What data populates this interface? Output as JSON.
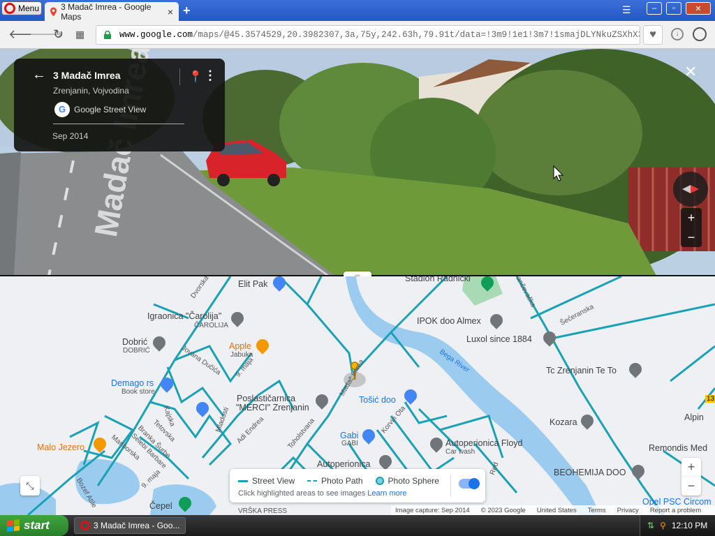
{
  "browser": {
    "menu_label": "Menu",
    "tab_title": "3 Madač Imrea - Google Maps",
    "tab_close": "×",
    "new_tab": "+",
    "url_host": "www.google.com",
    "url_path": "/maps/@45.3574529,20.3982307,3a,75y,242.63h,79.91t/data=!3m9!1e1!3m7!1smajDLYNkuZSXhX3vqZyr5A!2e0!7i",
    "window_buttons": [
      "–",
      "▫",
      "✕"
    ]
  },
  "streetview": {
    "place_title": "3 Madač Imrea",
    "place_subtitle": "Zrenjanin, Vojvodina",
    "provider": "Google Street View",
    "provider_logo": "G",
    "capture_date": "Sep 2014",
    "painted_street_text": "Madač Imrea",
    "close": "✕",
    "zoom_in": "+",
    "zoom_out": "−"
  },
  "map": {
    "labels": [
      {
        "text": "Elit Pak",
        "style": "normal"
      },
      {
        "text": "Stadion Radnički",
        "style": "normal"
      },
      {
        "text": "Pančevačka",
        "style": "sm"
      },
      {
        "text": "Igraonica \"Čarolija\"",
        "style": "normal"
      },
      {
        "text": "ČAROLIJA",
        "style": "sm"
      },
      {
        "text": "Dvorska",
        "style": "sm"
      },
      {
        "text": "IPOK doo Almex",
        "style": "normal"
      },
      {
        "text": "Šećeranska",
        "style": "sm"
      },
      {
        "text": "Luxol since 1884",
        "style": "normal"
      },
      {
        "text": "Dobrić",
        "style": "normal"
      },
      {
        "text": "DOBRIĆ",
        "style": "sm"
      },
      {
        "text": "Apple",
        "style": "orange"
      },
      {
        "text": "Jabuka",
        "style": "sm"
      },
      {
        "text": "Bega River",
        "style": "blue-sm"
      },
      {
        "text": "Tc Zrenjanin Te To",
        "style": "normal"
      },
      {
        "text": "Jovana Dučića",
        "style": "sm"
      },
      {
        "text": "9. maja",
        "style": "sm"
      },
      {
        "text": "Demago rs",
        "style": "blue"
      },
      {
        "text": "Book store",
        "style": "sm"
      },
      {
        "text": "Madač Imrea",
        "style": "sm"
      },
      {
        "text": "Poslastičarnica",
        "style": "normal"
      },
      {
        "text": "\"MERCI\" Zrenjanin",
        "style": "normal"
      },
      {
        "text": "Tošić doo",
        "style": "blue"
      },
      {
        "text": "Kozara",
        "style": "normal"
      },
      {
        "text": "Alpin",
        "style": "normal"
      },
      {
        "text": "Kajska",
        "style": "sm"
      },
      {
        "text": "Tetovska",
        "style": "sm"
      },
      {
        "text": "Mladosti",
        "style": "sm"
      },
      {
        "text": "Adi Endrea",
        "style": "sm"
      },
      {
        "text": "Toholstvana",
        "style": "sm"
      },
      {
        "text": "Korvin Ota",
        "style": "sm"
      },
      {
        "text": "Gabi",
        "style": "blue"
      },
      {
        "text": "GABI",
        "style": "sm"
      },
      {
        "text": "Autoperionica Floyd",
        "style": "normal"
      },
      {
        "text": "Car wash",
        "style": "sm"
      },
      {
        "text": "Branka Šurbe",
        "style": "sm"
      },
      {
        "text": "Selebi Barbare",
        "style": "sm"
      },
      {
        "text": "Mariborska",
        "style": "sm"
      },
      {
        "text": "Malo Jezero",
        "style": "orange"
      },
      {
        "text": "Autoperionica",
        "style": "normal"
      },
      {
        "text": "Remondis Med",
        "style": "normal"
      },
      {
        "text": "BEOHEMIJA DOO",
        "style": "normal"
      },
      {
        "text": "Bozef Atile",
        "style": "sm"
      },
      {
        "text": "9. maja",
        "style": "sm"
      },
      {
        "text": "Čepel",
        "style": "normal"
      },
      {
        "text": "VRŠKA PRESS",
        "style": "sm"
      },
      {
        "text": "Red",
        "style": "sm"
      },
      {
        "text": "Opel PSC Circom",
        "style": "blue"
      },
      {
        "text": "13",
        "style": "sm"
      }
    ],
    "legend": {
      "street_view": "Street View",
      "photo_path": "Photo Path",
      "photo_sphere": "Photo Sphere",
      "hint": "Click highlighted areas to see images",
      "learn_more": "Learn more",
      "toggle_on": true
    },
    "zoom_in": "+",
    "zoom_out": "−",
    "collapse_icon": "⤡",
    "footer": {
      "capture": "Image capture: Sep 2014",
      "copyright": "© 2023 Google",
      "country": "United States",
      "terms": "Terms",
      "privacy": "Privacy",
      "report": "Report a problem"
    },
    "colors": {
      "coverage": "#1aa1b5",
      "water": "#9ccbf0",
      "park": "#a8dab5"
    }
  },
  "taskbar": {
    "start_label": "start",
    "task_item": "3 Madač Imrea - Goo...",
    "clock": "12:10 PM"
  }
}
